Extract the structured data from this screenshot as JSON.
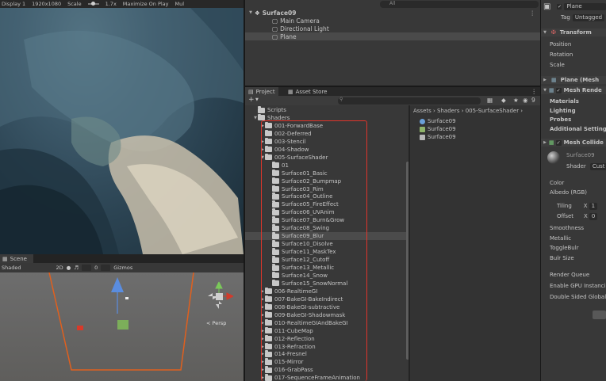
{
  "game": {
    "display": "Display 1",
    "resolution": "1920x1080",
    "scale_label": "Scale",
    "scale_value": "1.7x",
    "maximize": "Maximize On Play",
    "mute": "Mul"
  },
  "scene": {
    "tab": "Scene",
    "shading": "Shaded",
    "mode_2d": "2D",
    "gizmo_count": "0",
    "gizmos": "Gizmos",
    "persp": "< Persp"
  },
  "hierarchy": {
    "search_placeholder": "All",
    "root": "Surface09",
    "children": [
      "Main Camera",
      "Directional Light",
      "Plane"
    ]
  },
  "project": {
    "tabs": [
      "Project",
      "Asset Store"
    ],
    "add_label": "+",
    "visible_count": "9",
    "tree": [
      {
        "label": "Scripts",
        "depth": 0,
        "arrow": ""
      },
      {
        "label": "Shaders",
        "depth": 0,
        "arrow": "down"
      },
      {
        "label": "001-ForwardBase",
        "depth": 1,
        "arrow": "right"
      },
      {
        "label": "002-Deferred",
        "depth": 1,
        "arrow": ""
      },
      {
        "label": "003-Stencil",
        "depth": 1,
        "arrow": "right"
      },
      {
        "label": "004-Shadow",
        "depth": 1,
        "arrow": "right"
      },
      {
        "label": "005-SurfaceShader",
        "depth": 1,
        "arrow": "down"
      },
      {
        "label": "01",
        "depth": 2,
        "arrow": ""
      },
      {
        "label": "Surface01_Basic",
        "depth": 2,
        "arrow": ""
      },
      {
        "label": "Surface02_Bumpmap",
        "depth": 2,
        "arrow": ""
      },
      {
        "label": "Surface03_Rim",
        "depth": 2,
        "arrow": ""
      },
      {
        "label": "Surface04_Outline",
        "depth": 2,
        "arrow": ""
      },
      {
        "label": "Surface05_FireEffect",
        "depth": 2,
        "arrow": ""
      },
      {
        "label": "Surface06_UVAnim",
        "depth": 2,
        "arrow": ""
      },
      {
        "label": "Surface07_Burn&Grow",
        "depth": 2,
        "arrow": ""
      },
      {
        "label": "Surface08_Swing",
        "depth": 2,
        "arrow": ""
      },
      {
        "label": "Surface09_Blur",
        "depth": 2,
        "arrow": "",
        "selected": true
      },
      {
        "label": "Surface10_Disolve",
        "depth": 2,
        "arrow": ""
      },
      {
        "label": "Surface11_MaskTex",
        "depth": 2,
        "arrow": ""
      },
      {
        "label": "Surface12_Cutoff",
        "depth": 2,
        "arrow": ""
      },
      {
        "label": "Surface13_Metallic",
        "depth": 2,
        "arrow": ""
      },
      {
        "label": "Surface14_Snow",
        "depth": 2,
        "arrow": ""
      },
      {
        "label": "Surface15_SnowNormal",
        "depth": 2,
        "arrow": ""
      },
      {
        "label": "006-RealtimeGI",
        "depth": 1,
        "arrow": "right"
      },
      {
        "label": "007-BakeGI-BakeIndirect",
        "depth": 1,
        "arrow": "right"
      },
      {
        "label": "008-BakeGI-subtractive",
        "depth": 1,
        "arrow": "right"
      },
      {
        "label": "009-BakeGI-Shadowmask",
        "depth": 1,
        "arrow": "right"
      },
      {
        "label": "010-RealtimeGIAndBakeGI",
        "depth": 1,
        "arrow": "right"
      },
      {
        "label": "011-CubeMap",
        "depth": 1,
        "arrow": "right"
      },
      {
        "label": "012-Reflection",
        "depth": 1,
        "arrow": "right"
      },
      {
        "label": "013-Refraction",
        "depth": 1,
        "arrow": "right"
      },
      {
        "label": "014-Fresnel",
        "depth": 1,
        "arrow": "right"
      },
      {
        "label": "015-Mirror",
        "depth": 1,
        "arrow": "right"
      },
      {
        "label": "016-GrabPass",
        "depth": 1,
        "arrow": "right"
      },
      {
        "label": "017-SequenceFrameAnimation",
        "depth": 1,
        "arrow": "right"
      }
    ],
    "breadcrumb": "Assets › Shaders › 005-SurfaceShader ›",
    "assets": [
      {
        "label": "Surface09",
        "icon": "material-sphere-icon",
        "color": "#6aa0d8"
      },
      {
        "label": "Surface09",
        "icon": "scene-icon",
        "color": "#8fb36a"
      },
      {
        "label": "Surface09",
        "icon": "shader-icon",
        "color": "#b8b8b8"
      }
    ]
  },
  "inspector": {
    "object_name": "Plane",
    "tag_label": "Tag",
    "tag_value": "Untagged",
    "transform": "Transform",
    "transform_fields": [
      "Position",
      "Rotation",
      "Scale"
    ],
    "mesh_filter": "Plane (Mesh",
    "mesh_renderer": "Mesh Rende",
    "renderer_sections": [
      "Materials",
      "Lighting",
      "Probes",
      "Additional Settings"
    ],
    "mesh_collider": "Mesh Collide",
    "material_name": "Surface09",
    "shader_label": "Shader",
    "shader_value": "Cust",
    "props": [
      "Color",
      "Albedo (RGB)"
    ],
    "tiling": "Tiling",
    "offset": "Offset",
    "tiling_x": "X",
    "tiling_val": "1",
    "offset_x": "X",
    "offset_val": "0",
    "props2": [
      "Smoothness",
      "Metallic",
      "ToggleBulr",
      "Bulr Size"
    ],
    "props3": [
      "Render Queue",
      "Enable GPU Instanci",
      "Double Sided Global"
    ]
  }
}
